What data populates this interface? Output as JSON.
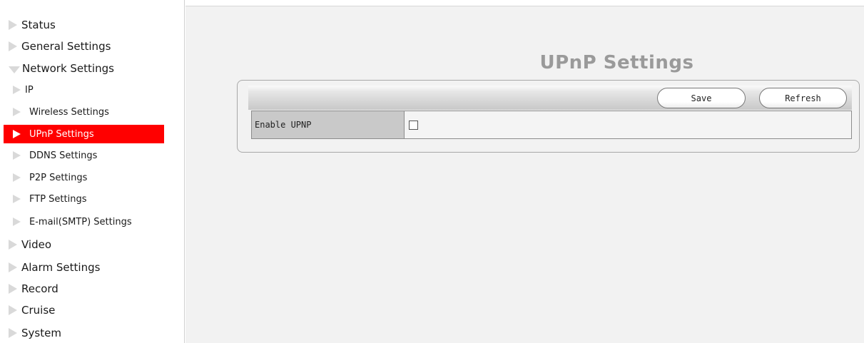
{
  "sidebar": {
    "items": [
      {
        "label": "Status"
      },
      {
        "label": "General Settings"
      },
      {
        "label": "Network Settings"
      },
      {
        "label": "IP"
      },
      {
        "label": "Wireless Settings"
      },
      {
        "label": "UPnP Settings"
      },
      {
        "label": "DDNS Settings"
      },
      {
        "label": "P2P Settings"
      },
      {
        "label": "FTP Settings"
      },
      {
        "label": "E-mail(SMTP) Settings"
      },
      {
        "label": "Video"
      },
      {
        "label": "Alarm Settings"
      },
      {
        "label": "Record"
      },
      {
        "label": "Cruise"
      },
      {
        "label": "System"
      }
    ],
    "active_item": "UPnP Settings",
    "expanded_group": "Network Settings",
    "active_color": "#ff0000"
  },
  "main": {
    "title": "UPnP Settings",
    "toolbar": {
      "save_label": "Save",
      "refresh_label": "Refresh"
    },
    "form": {
      "enable_upnp_label": "Enable UPNP",
      "enable_upnp_checked": false
    }
  }
}
